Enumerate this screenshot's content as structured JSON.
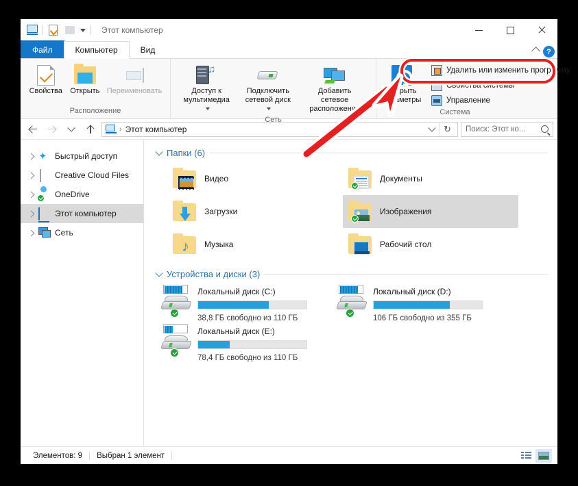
{
  "window": {
    "title": "Этот компьютер",
    "minimize_label": "Свернуть",
    "maximize_label": "Развернуть",
    "close_label": "Закрыть"
  },
  "quick_access_toolbar": {
    "items": [
      {
        "name": "pc-icon",
        "label": "Этот компьютер"
      },
      {
        "name": "properties-icon",
        "label": "Свойства"
      },
      {
        "name": "new-folder-icon",
        "label": "Создать папку"
      },
      {
        "name": "customize-caret",
        "label": "Настройка панели быстрого доступа"
      }
    ]
  },
  "tabs": [
    {
      "id": "file",
      "label": "Файл"
    },
    {
      "id": "computer",
      "label": "Компьютер"
    },
    {
      "id": "view",
      "label": "Вид"
    }
  ],
  "ribbon": {
    "collapse_label": "Свернуть ленту",
    "help_label": "?",
    "groups": [
      {
        "id": "location",
        "label": "Расположение",
        "buttons": [
          {
            "id": "properties",
            "label": "Свойства",
            "icon": "properties-icon",
            "disabled": false,
            "dropdown": false
          },
          {
            "id": "open",
            "label": "Открыть",
            "icon": "open-folder-icon",
            "disabled": false,
            "dropdown": false
          },
          {
            "id": "rename",
            "label": "Переименовать",
            "icon": "rename-icon",
            "disabled": true,
            "dropdown": false
          }
        ]
      },
      {
        "id": "network",
        "label": "Сеть",
        "buttons": [
          {
            "id": "media",
            "label": "Доступ к\nмультимедиа",
            "icon": "media-server-icon",
            "disabled": false,
            "dropdown": true
          },
          {
            "id": "map-drive",
            "label": "Подключить\nсетевой диск",
            "icon": "network-drive-icon",
            "disabled": false,
            "dropdown": true
          },
          {
            "id": "add-network-location",
            "label": "Добавить сетевое\nрасположение",
            "icon": "network-location-icon",
            "disabled": false,
            "dropdown": false
          }
        ]
      },
      {
        "id": "system",
        "label": "Система",
        "buttons": [
          {
            "id": "open-settings",
            "label": "Открыть\nпараметры",
            "icon": "gear-icon",
            "disabled": false,
            "dropdown": false
          }
        ],
        "menu_items": [
          {
            "id": "uninstall-change-program",
            "label": "Удалить или изменить программу",
            "icon": "uninstall-icon",
            "highlighted": true
          },
          {
            "id": "system-properties",
            "label": "Свойства системы",
            "icon": "system-properties-icon",
            "highlighted": false
          },
          {
            "id": "manage",
            "label": "Управление",
            "icon": "manage-icon",
            "highlighted": false
          }
        ]
      }
    ]
  },
  "address_bar": {
    "back_label": "Назад",
    "forward_label": "Вперед",
    "recent_label": "Последние расположения",
    "up_label": "Вверх",
    "breadcrumb": [
      "Этот компьютер"
    ],
    "dropdown_label": "Предыдущие расположения",
    "refresh_label": "Обновить",
    "refresh_glyph": "↻"
  },
  "search": {
    "value": "Поиск: Этот ко...",
    "placeholder": "Поиск: Этот компьютер"
  },
  "navigation_pane": {
    "items": [
      {
        "id": "quick-access",
        "label": "Быстрый доступ",
        "icon": "star-icon",
        "selected": false,
        "cloud_check": false
      },
      {
        "id": "creative-cloud-files",
        "label": "Creative Cloud Files",
        "icon": "document-icon",
        "selected": false,
        "cloud_check": false
      },
      {
        "id": "onedrive",
        "label": "OneDrive",
        "icon": "cloud-icon",
        "selected": false,
        "cloud_check": true
      },
      {
        "id": "this-pc",
        "label": "Этот компьютер",
        "icon": "pc-icon",
        "selected": true,
        "cloud_check": false
      },
      {
        "id": "network",
        "label": "Сеть",
        "icon": "network-icon",
        "selected": false,
        "cloud_check": false
      }
    ]
  },
  "content": {
    "sections": [
      {
        "id": "folders",
        "title": "Папки (6)",
        "items": [
          {
            "id": "video",
            "label": "Видео",
            "icon": "video-folder-icon",
            "selected": false,
            "sync_check": false
          },
          {
            "id": "documents",
            "label": "Документы",
            "icon": "documents-folder-icon",
            "selected": false,
            "sync_check": true
          },
          {
            "id": "downloads",
            "label": "Загрузки",
            "icon": "downloads-folder-icon",
            "selected": false,
            "sync_check": false
          },
          {
            "id": "pictures",
            "label": "Изображения",
            "icon": "pictures-folder-icon",
            "selected": true,
            "sync_check": true
          },
          {
            "id": "music",
            "label": "Музыка",
            "icon": "music-folder-icon",
            "selected": false,
            "sync_check": false
          },
          {
            "id": "desktop",
            "label": "Рабочий стол",
            "icon": "desktop-folder-icon",
            "selected": false,
            "sync_check": false
          }
        ]
      },
      {
        "id": "devices",
        "title": "Устройства и диски (3)",
        "items": [
          {
            "id": "drive-c",
            "label": "Локальный диск (C:)",
            "free_text": "38,8 ГБ свободно из 110 ГБ",
            "used_percent": 65
          },
          {
            "id": "drive-d",
            "label": "Локальный диск (D:)",
            "free_text": "106 ГБ свободно из 355 ГБ",
            "used_percent": 70
          },
          {
            "id": "drive-e",
            "label": "Локальный диск (E:)",
            "free_text": "78,4 ГБ свободно из 110 ГБ",
            "used_percent": 29
          }
        ]
      }
    ]
  },
  "status_bar": {
    "item_count": "Элементов: 9",
    "selection": "Выбран 1 элемент",
    "view_details_label": "Крупные значки",
    "view_tiles_label": "Таблица"
  },
  "annotation": {
    "accent_color": "#e62020",
    "highlight_target": "Удалить или изменить программу"
  }
}
